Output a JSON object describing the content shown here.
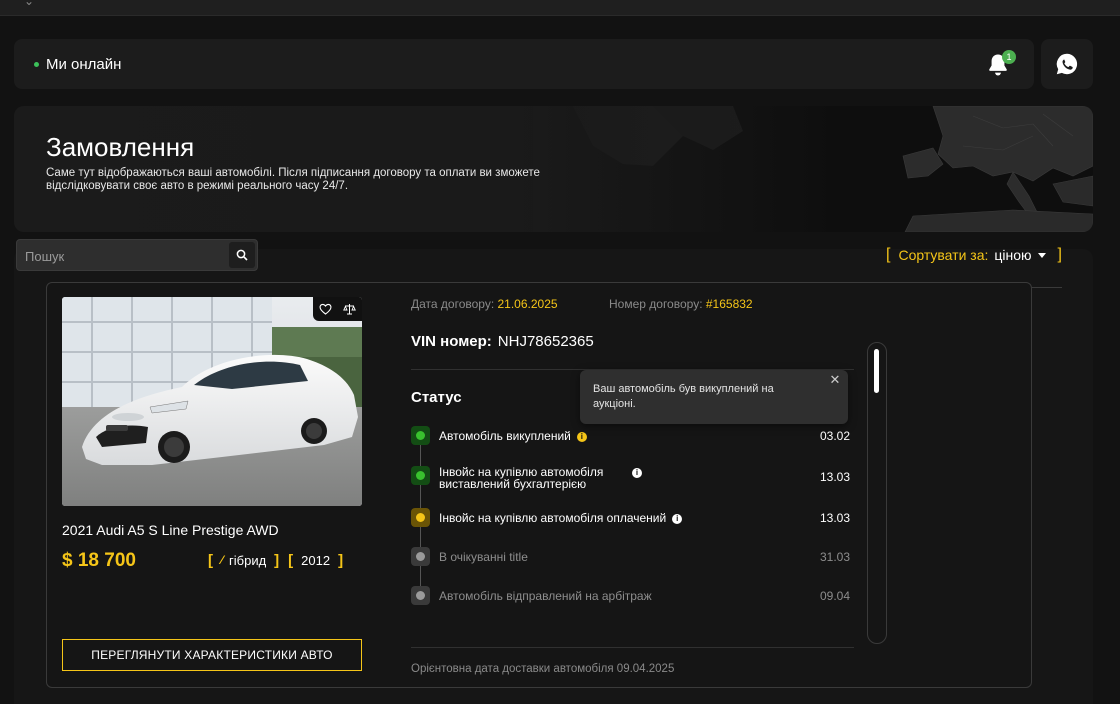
{
  "header": {
    "online_text": "Ми онлайн",
    "notifications_count": "1",
    "accent_green": "#3cc15a"
  },
  "hero": {
    "title": "Замовлення",
    "subtitle": "Саме тут відображаються ваші автомобілі. Після підписання договору та оплати ви зможете відслідковувати своє авто в режимі реального часу 24/7."
  },
  "search": {
    "placeholder": "Пошук"
  },
  "sort": {
    "label": "Сортувати за:",
    "value": "ціною"
  },
  "order": {
    "car_name": "2021 Audi A5 S Line Prestige AWD",
    "price": "$ 18 700",
    "fuel": "гібрид",
    "year": "2012",
    "specs_button": "ПЕРЕГЛЯНУТИ ХАРАКТЕРИСТИКИ АВТО",
    "contract_date_label": "Дата договору:",
    "contract_date": "21.06.2025",
    "contract_number_label": "Номер договору:",
    "contract_number": "#165832",
    "vin_label": "VIN номер:",
    "vin": "NHJ78652365",
    "status_title": "Статус",
    "delivery_text": "Орієнтовна дата доставки автомобіля 09.04.2025",
    "steps": [
      {
        "label": "Автомобіль викуплений",
        "date": "03.02",
        "state": "done",
        "color": "#39c12e"
      },
      {
        "label": "Інвойс на купівлю автомобіля виставлений бухгалтерією",
        "date": "13.03",
        "state": "done",
        "color": "#39c12e"
      },
      {
        "label": "Інвойс на купівлю автомобіля оплачений",
        "date": "13.03",
        "state": "current",
        "color": "#f5c518"
      },
      {
        "label": "В очікуванні title",
        "date": "31.03",
        "state": "pending",
        "color": "#9a9a9a"
      },
      {
        "label": "Автомобіль відправлений на арбітраж",
        "date": "09.04",
        "state": "pending",
        "color": "#9a9a9a"
      }
    ],
    "tooltip": "Ваш автомобіль був викуплений на аукціоні."
  },
  "colors": {
    "accent": "#f5c518",
    "background": "#121212"
  }
}
